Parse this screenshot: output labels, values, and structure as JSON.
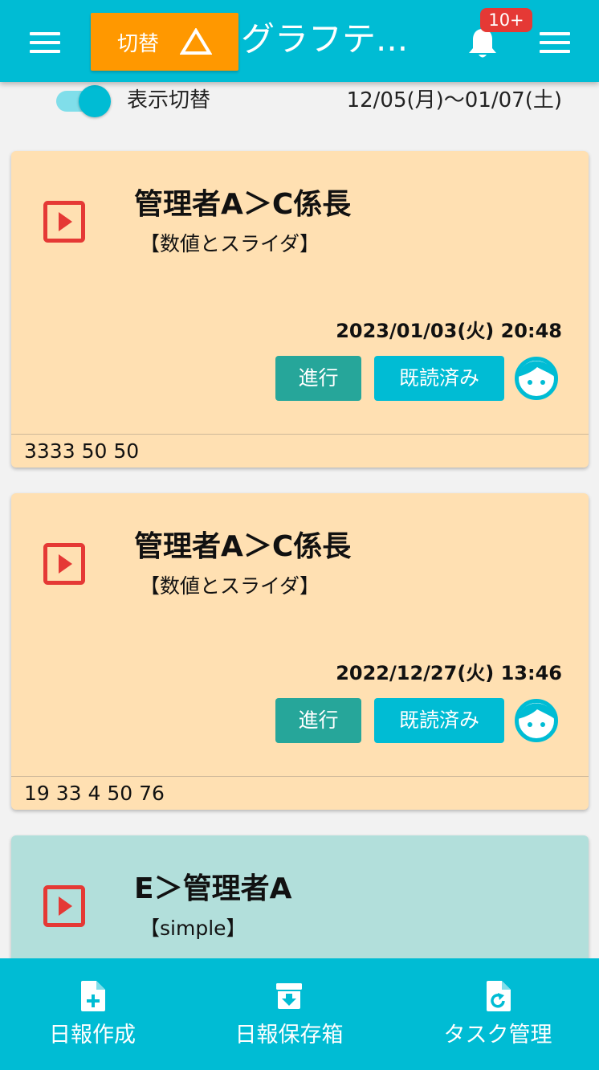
{
  "header": {
    "switch_label": "切替",
    "title": "グラフテ...",
    "notification_count": "10+"
  },
  "subbar": {
    "toggle_label": "表示切替",
    "toggle_on": true,
    "date_range": "12/05(月)〜01/07(土)"
  },
  "cards": [
    {
      "sender": "管理者A＞C係長",
      "form_name": "【数値とスライダ】",
      "datetime": "2023/01/03(火) 20:48",
      "status_button": "進行",
      "read_button": "既読済み",
      "values": "3333 50 50",
      "color": "#ffe0b2"
    },
    {
      "sender": "管理者A＞C係長",
      "form_name": "【数値とスライダ】",
      "datetime": "2022/12/27(火) 13:46",
      "status_button": "進行",
      "read_button": "既読済み",
      "values": "19 33 4 50 76",
      "color": "#ffe0b2"
    },
    {
      "sender": "E＞管理者A",
      "form_name": "【simple】",
      "color": "#b2dfdb"
    }
  ],
  "bottom_nav": [
    {
      "label": "日報作成",
      "icon": "file-add-icon"
    },
    {
      "label": "日報保存箱",
      "icon": "archive-download-icon"
    },
    {
      "label": "タスク管理",
      "icon": "file-refresh-icon"
    }
  ],
  "colors": {
    "primary": "#00bcd4",
    "accent_orange": "#ff9800",
    "badge_red": "#e53935",
    "progress_green": "#26a69a",
    "play_red": "#e53935"
  }
}
